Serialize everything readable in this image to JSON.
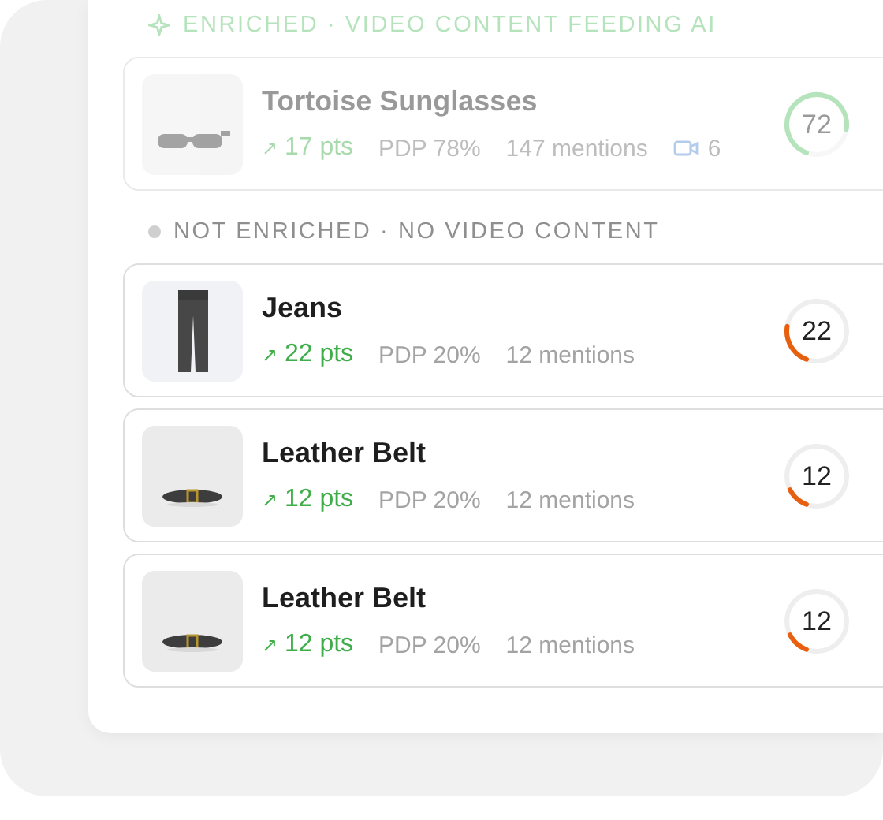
{
  "sections": [
    {
      "kind": "enriched",
      "label": "ENRICHED · VIDEO CONTENT FEEDING AI",
      "items": [
        {
          "name": "Tortoise Sunglasses",
          "trend": "↗",
          "pts": "17 pts",
          "pdp": "PDP 78%",
          "mentions": "147 mentions",
          "videos": "6",
          "score": "72"
        }
      ]
    },
    {
      "kind": "not_enriched",
      "label": "NOT ENRICHED · NO VIDEO CONTENT",
      "items": [
        {
          "name": "Jeans",
          "trend": "↗",
          "pts": "22 pts",
          "pdp": "PDP 20%",
          "mentions": "12 mentions",
          "score": "22"
        },
        {
          "name": "Leather Belt",
          "trend": "↗",
          "pts": "12 pts",
          "pdp": "PDP 20%",
          "mentions": "12 mentions",
          "score": "12"
        },
        {
          "name": "Leather Belt",
          "trend": "↗",
          "pts": "12 pts",
          "pdp": "PDP 20%",
          "mentions": "12 mentions",
          "score": "12"
        }
      ]
    }
  ]
}
